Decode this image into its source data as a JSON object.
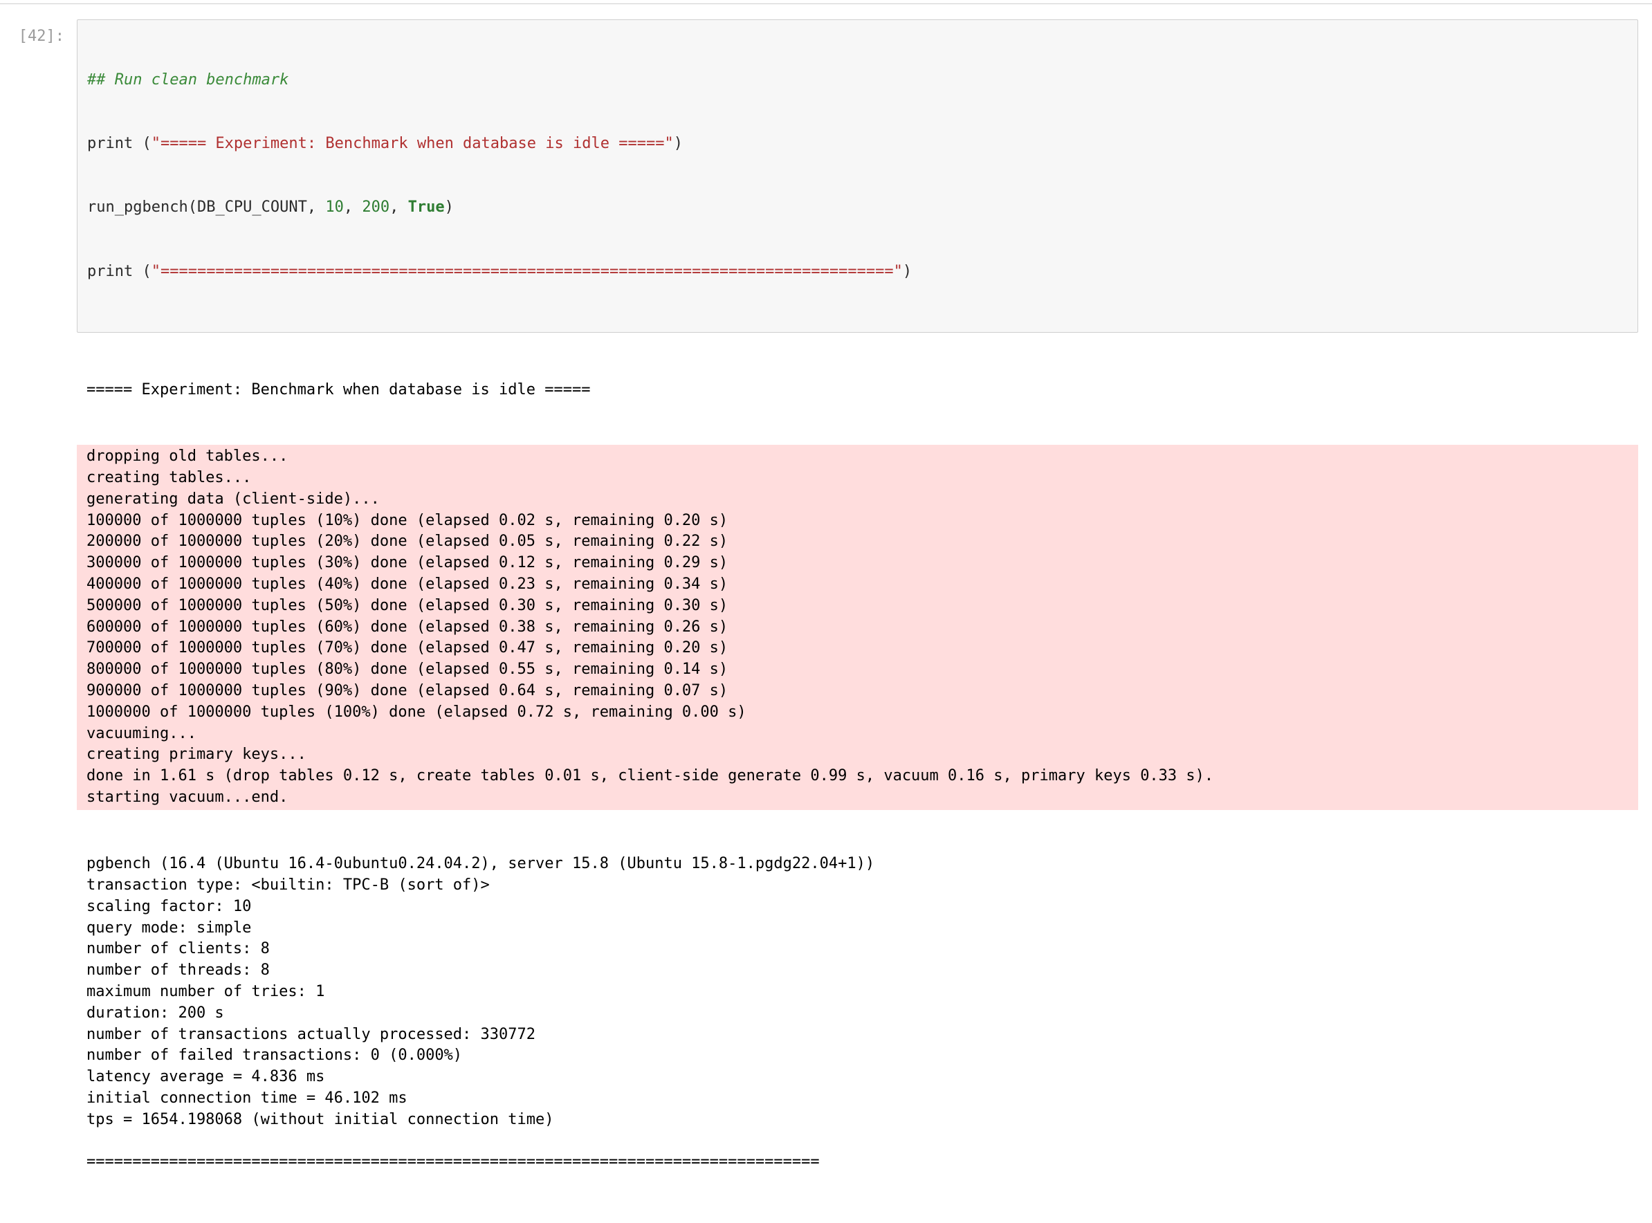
{
  "prompt": "[42]:",
  "code": {
    "comment": "## Run clean benchmark",
    "print1_open": "print (",
    "print1_str": "\"===== Experiment: Benchmark when database is idle =====\"",
    "print1_close": ")",
    "run_name": "run_pgbench",
    "run_open": "(",
    "arg1": "DB_CPU_COUNT",
    "comma": ", ",
    "arg2": "10",
    "arg3": "200",
    "arg4": "True",
    "run_close": ")",
    "print2_open": "print (",
    "print2_str": "\"================================================================================\"",
    "print2_close": ")"
  },
  "output": {
    "header": "===== Experiment: Benchmark when database is idle =====",
    "stderr": "dropping old tables...\ncreating tables...\ngenerating data (client-side)...\n100000 of 1000000 tuples (10%) done (elapsed 0.02 s, remaining 0.20 s)\n200000 of 1000000 tuples (20%) done (elapsed 0.05 s, remaining 0.22 s)\n300000 of 1000000 tuples (30%) done (elapsed 0.12 s, remaining 0.29 s)\n400000 of 1000000 tuples (40%) done (elapsed 0.23 s, remaining 0.34 s)\n500000 of 1000000 tuples (50%) done (elapsed 0.30 s, remaining 0.30 s)\n600000 of 1000000 tuples (60%) done (elapsed 0.38 s, remaining 0.26 s)\n700000 of 1000000 tuples (70%) done (elapsed 0.47 s, remaining 0.20 s)\n800000 of 1000000 tuples (80%) done (elapsed 0.55 s, remaining 0.14 s)\n900000 of 1000000 tuples (90%) done (elapsed 0.64 s, remaining 0.07 s)\n1000000 of 1000000 tuples (100%) done (elapsed 0.72 s, remaining 0.00 s)\nvacuuming...\ncreating primary keys...\ndone in 1.61 s (drop tables 0.12 s, create tables 0.01 s, client-side generate 0.99 s, vacuum 0.16 s, primary keys 0.33 s).\nstarting vacuum...end.",
    "stdout": "pgbench (16.4 (Ubuntu 16.4-0ubuntu0.24.04.2), server 15.8 (Ubuntu 15.8-1.pgdg22.04+1))\ntransaction type: <builtin: TPC-B (sort of)>\nscaling factor: 10\nquery mode: simple\nnumber of clients: 8\nnumber of threads: 8\nmaximum number of tries: 1\nduration: 200 s\nnumber of transactions actually processed: 330772\nnumber of failed transactions: 0 (0.000%)\nlatency average = 4.836 ms\ninitial connection time = 46.102 ms\ntps = 1654.198068 (without initial connection time)\n\n================================================================================"
  }
}
